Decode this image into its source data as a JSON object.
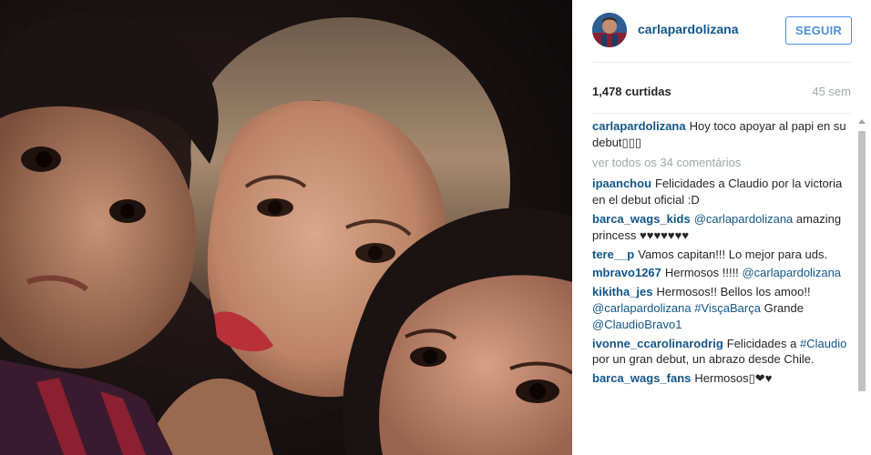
{
  "post": {
    "username": "carlapardolizana",
    "follow_label": "SEGUIR",
    "likes": "1,478 curtidas",
    "time": "45 sem",
    "caption": {
      "user": "carlapardolizana",
      "text": "Hoy toco apoyar al papi en su debut▯▯▯"
    },
    "view_all": "ver todos os 34 comentários",
    "comments": [
      {
        "user": "ipaanchou",
        "text": "Felicidades a Claudio por la victoria en el debut oficial :D"
      },
      {
        "user": "barca_wags_kids",
        "mention": "@carlapardolizana",
        "text": "amazing princess ♥♥♥♥♥♥♥"
      },
      {
        "user": "tere__p",
        "text": "Vamos capitan!!! Lo mejor para uds."
      },
      {
        "user": "mbravo1267",
        "text": "Hermosos !!!!!",
        "mention": "@carlapardolizana"
      },
      {
        "user": "kikitha_jes",
        "text": "Hermosos!! Bellos los amoo!!",
        "mention": "@carlapardolizana",
        "hashtag": "#VisçaBarça",
        "text2": "Grande",
        "mention2": "@ClaudioBravo1"
      },
      {
        "user": "ivonne_ccarolinarodrig",
        "text": "Felicidades a",
        "hashtag": "#Claudio",
        "text2": "por un gran debut, un abrazo desde Chile."
      },
      {
        "user": "barca_wags_fans",
        "text": "Hermosos▯❤♥"
      }
    ]
  },
  "colors": {
    "username_blue": "#125688",
    "follow_blue": "#4990e2",
    "muted_gray": "#a5a7aa"
  },
  "icons": {
    "avatar": "user-avatar-photo",
    "scroll_up": "arrow-up-icon"
  },
  "photo": {
    "description": "selfie-photo"
  }
}
